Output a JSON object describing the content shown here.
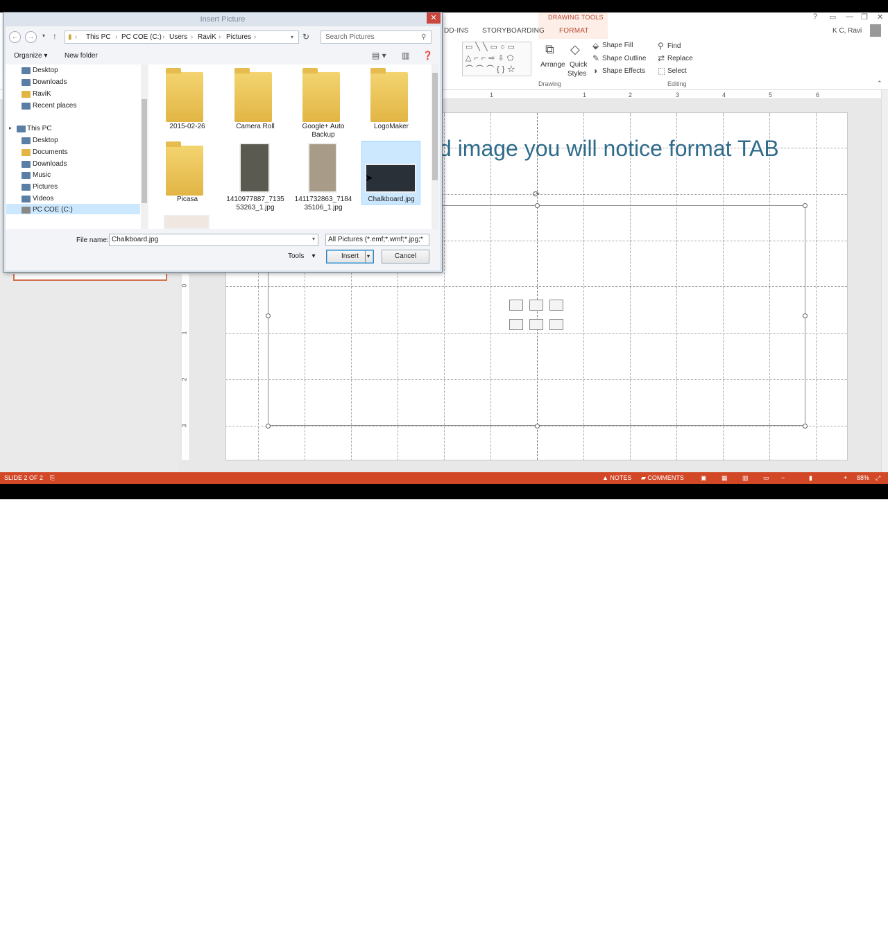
{
  "ribbon": {
    "contextual_group": "DRAWING TOOLS",
    "tabs": [
      "DD-INS",
      "STORYBOARDING",
      "FORMAT"
    ],
    "user_name": "K C, Ravi",
    "drawing_group": {
      "label": "Drawing",
      "arrange": "Arrange",
      "quick_styles_1": "Quick",
      "quick_styles_2": "Styles",
      "shape_fill": "Shape Fill",
      "shape_outline": "Shape Outline",
      "shape_effects": "Shape Effects"
    },
    "editing_group": {
      "label": "Editing",
      "find": "Find",
      "replace": "Replace",
      "select": "Select"
    }
  },
  "ruler": {
    "h_numbers": [
      "1",
      "1",
      "2",
      "3",
      "4",
      "5",
      "6"
    ],
    "v_numbers": [
      "0",
      "1",
      "2",
      "3"
    ]
  },
  "slide": {
    "title_visible": "d image you will notice format TAB"
  },
  "status": {
    "slide_indicator": "SLIDE 2 OF 2",
    "notes": "NOTES",
    "comments": "COMMENTS",
    "zoom": "88%"
  },
  "dialog": {
    "title": "Insert Picture",
    "breadcrumb": [
      "This PC",
      "PC COE (C:)",
      "Users",
      "RaviK",
      "Pictures"
    ],
    "search_placeholder": "Search Pictures",
    "organize": "Organize",
    "new_folder": "New folder",
    "nav_items": [
      {
        "label": "Desktop"
      },
      {
        "label": "Downloads"
      },
      {
        "label": "RaviK"
      },
      {
        "label": "Recent places"
      },
      {
        "label": "This PC"
      },
      {
        "label": "Desktop"
      },
      {
        "label": "Documents"
      },
      {
        "label": "Downloads"
      },
      {
        "label": "Music"
      },
      {
        "label": "Pictures"
      },
      {
        "label": "Videos"
      },
      {
        "label": "PC COE (C:)"
      }
    ],
    "files": [
      {
        "name_1": "2015-02-26",
        "name_2": ""
      },
      {
        "name_1": "Camera Roll",
        "name_2": ""
      },
      {
        "name_1": "Google+ Auto",
        "name_2": "Backup"
      },
      {
        "name_1": "LogoMaker",
        "name_2": ""
      },
      {
        "name_1": "Picasa",
        "name_2": ""
      },
      {
        "name_1": "1410977887_7135",
        "name_2": "53263_1.jpg"
      },
      {
        "name_1": "1411732863_7184",
        "name_2": "35106_1.jpg"
      },
      {
        "name_1": "Chalkboard.jpg",
        "name_2": ""
      }
    ],
    "file_name_label": "File name:",
    "file_name_value": "Chalkboard.jpg",
    "file_type": "All Pictures (*.emf;*.wmf;*.jpg;*",
    "tools": "Tools",
    "insert": "Insert",
    "cancel": "Cancel"
  },
  "colors": {
    "accent": "#d24726",
    "title_text": "#2e6b8a",
    "selection": "#cce8ff"
  }
}
